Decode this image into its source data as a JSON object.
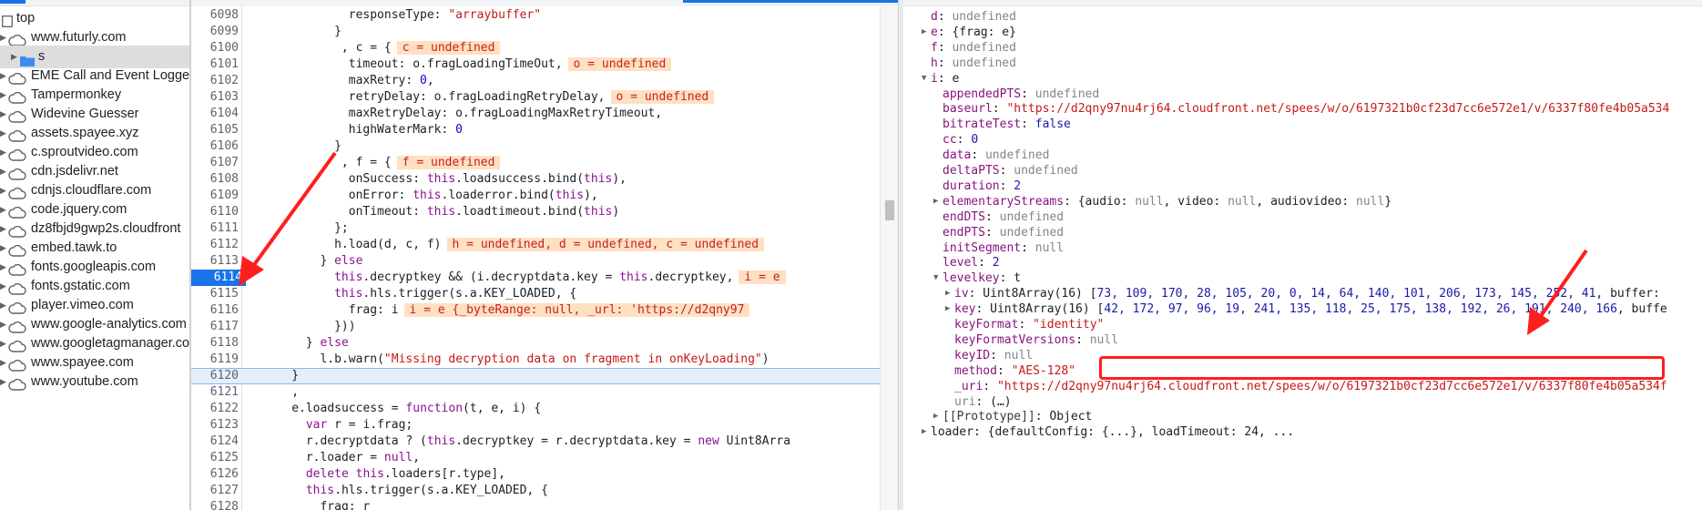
{
  "sidebar": {
    "items": [
      {
        "label": "top",
        "kind": "plain"
      },
      {
        "label": "www.futurly.com",
        "kind": "cloud"
      },
      {
        "label": "s",
        "kind": "folder",
        "selected": true
      },
      {
        "label": "EME Call and Event Logger",
        "kind": "cloud"
      },
      {
        "label": "Tampermonkey",
        "kind": "cloud"
      },
      {
        "label": "Widevine Guesser",
        "kind": "cloud"
      },
      {
        "label": "assets.spayee.xyz",
        "kind": "cloud"
      },
      {
        "label": "c.sproutvideo.com",
        "kind": "cloud"
      },
      {
        "label": "cdn.jsdelivr.net",
        "kind": "cloud"
      },
      {
        "label": "cdnjs.cloudflare.com",
        "kind": "cloud"
      },
      {
        "label": "code.jquery.com",
        "kind": "cloud"
      },
      {
        "label": "dz8fbjd9gwp2s.cloudfront",
        "kind": "cloud"
      },
      {
        "label": "embed.tawk.to",
        "kind": "cloud"
      },
      {
        "label": "fonts.googleapis.com",
        "kind": "cloud"
      },
      {
        "label": "fonts.gstatic.com",
        "kind": "cloud"
      },
      {
        "label": "player.vimeo.com",
        "kind": "cloud"
      },
      {
        "label": "www.google-analytics.com",
        "kind": "cloud"
      },
      {
        "label": "www.googletagmanager.co",
        "kind": "cloud"
      },
      {
        "label": "www.spayee.com",
        "kind": "cloud"
      },
      {
        "label": "www.youtube.com",
        "kind": "cloud"
      }
    ]
  },
  "editor": {
    "lines": [
      {
        "n": "6098",
        "indent": 29,
        "parts": [
          [
            "p",
            "responseType: "
          ],
          [
            "s",
            "\"arraybuffer\""
          ]
        ]
      },
      {
        "n": "6099",
        "indent": 25,
        "parts": [
          [
            "p",
            "}"
          ]
        ]
      },
      {
        "n": "6100",
        "indent": 27,
        "parts": [
          [
            "p",
            ", c = {"
          ]
        ],
        "ann": "c = undefined"
      },
      {
        "n": "6101",
        "indent": 29,
        "parts": [
          [
            "p",
            "timeout: o.fragLoadingTimeOut,"
          ]
        ],
        "ann": "o = undefined"
      },
      {
        "n": "6102",
        "indent": 29,
        "parts": [
          [
            "p",
            "maxRetry: "
          ],
          [
            "n",
            "0"
          ],
          [
            "p",
            ","
          ]
        ]
      },
      {
        "n": "6103",
        "indent": 29,
        "parts": [
          [
            "p",
            "retryDelay: o.fragLoadingRetryDelay,"
          ]
        ],
        "ann": "o = undefined"
      },
      {
        "n": "6104",
        "indent": 29,
        "parts": [
          [
            "p",
            "maxRetryDelay: o.fragLoadingMaxRetryTimeout,"
          ]
        ]
      },
      {
        "n": "6105",
        "indent": 29,
        "parts": [
          [
            "p",
            "highWaterMark: "
          ],
          [
            "n",
            "0"
          ]
        ]
      },
      {
        "n": "6106",
        "indent": 25,
        "parts": [
          [
            "p",
            "}"
          ]
        ]
      },
      {
        "n": "6107",
        "indent": 27,
        "parts": [
          [
            "p",
            ", f = {"
          ]
        ],
        "ann": "f = undefined"
      },
      {
        "n": "6108",
        "indent": 29,
        "parts": [
          [
            "p",
            "onSuccess: "
          ],
          [
            "k",
            "this"
          ],
          [
            "p",
            ".loadsuccess.bind("
          ],
          [
            "k",
            "this"
          ],
          [
            "p",
            "),"
          ]
        ]
      },
      {
        "n": "6109",
        "indent": 29,
        "parts": [
          [
            "p",
            "onError: "
          ],
          [
            "k",
            "this"
          ],
          [
            "p",
            ".loaderror.bind("
          ],
          [
            "k",
            "this"
          ],
          [
            "p",
            "),"
          ]
        ]
      },
      {
        "n": "6110",
        "indent": 29,
        "parts": [
          [
            "p",
            "onTimeout: "
          ],
          [
            "k",
            "this"
          ],
          [
            "p",
            ".loadtimeout.bind("
          ],
          [
            "k",
            "this"
          ],
          [
            "p",
            ")"
          ]
        ]
      },
      {
        "n": "6111",
        "indent": 25,
        "parts": [
          [
            "p",
            "};"
          ]
        ]
      },
      {
        "n": "6112",
        "indent": 25,
        "parts": [
          [
            "p",
            "h.load(d, c, f)"
          ]
        ],
        "ann": "h = undefined, d = undefined, c = undefined"
      },
      {
        "n": "6113",
        "indent": 21,
        "parts": [
          [
            "p",
            "} "
          ],
          [
            "k",
            "else"
          ]
        ]
      },
      {
        "n": "6114",
        "indent": 25,
        "bp": true,
        "parts": [
          [
            "k",
            "this"
          ],
          [
            "p",
            ".decryptkey && (i.decryptdata.key = "
          ],
          [
            "k",
            "this"
          ],
          [
            "p",
            ".decryptkey,"
          ]
        ],
        "ann": "i = e"
      },
      {
        "n": "6115",
        "indent": 25,
        "parts": [
          [
            "k",
            "this"
          ],
          [
            "p",
            ".hls.trigger(s.a.KEY_LOADED, {"
          ]
        ]
      },
      {
        "n": "6116",
        "indent": 29,
        "parts": [
          [
            "p",
            "frag: i"
          ]
        ],
        "ann": "i = e {_byteRange: null, _url: 'https://d2qny97"
      },
      {
        "n": "6117",
        "indent": 25,
        "parts": [
          [
            "p",
            "}))"
          ]
        ]
      },
      {
        "n": "6118",
        "indent": 17,
        "parts": [
          [
            "p",
            "} "
          ],
          [
            "k",
            "else"
          ]
        ]
      },
      {
        "n": "6119",
        "indent": 21,
        "parts": [
          [
            "p",
            "l.b.warn("
          ],
          [
            "s",
            "\"Missing decryption data on fragment in onKeyLoading\""
          ],
          [
            "p",
            ")"
          ]
        ]
      },
      {
        "n": "6120",
        "indent": 13,
        "current": true,
        "parts": [
          [
            "h",
            "}"
          ]
        ]
      },
      {
        "n": "6121",
        "indent": 13,
        "parts": [
          [
            "p",
            ","
          ]
        ]
      },
      {
        "n": "6122",
        "indent": 13,
        "parts": [
          [
            "p",
            "e.loadsuccess = "
          ],
          [
            "k",
            "function"
          ],
          [
            "p",
            "(t, e, i) {"
          ]
        ]
      },
      {
        "n": "6123",
        "indent": 17,
        "parts": [
          [
            "k",
            "var"
          ],
          [
            "p",
            " r = i.frag;"
          ]
        ]
      },
      {
        "n": "6124",
        "indent": 17,
        "parts": [
          [
            "p",
            "r.decryptdata ? ("
          ],
          [
            "k",
            "this"
          ],
          [
            "p",
            ".decryptkey = r.decryptdata.key = "
          ],
          [
            "k",
            "new"
          ],
          [
            "p",
            " Uint8Arra"
          ]
        ]
      },
      {
        "n": "6125",
        "indent": 17,
        "parts": [
          [
            "p",
            "r.loader = "
          ],
          [
            "k",
            "null"
          ],
          [
            "p",
            ","
          ]
        ]
      },
      {
        "n": "6126",
        "indent": 17,
        "parts": [
          [
            "k",
            "delete this"
          ],
          [
            "p",
            ".loaders[r.type],"
          ]
        ]
      },
      {
        "n": "6127",
        "indent": 17,
        "parts": [
          [
            "k",
            "this"
          ],
          [
            "p",
            ".hls.trigger(s.a.KEY_LOADED, {"
          ]
        ]
      },
      {
        "n": "6128",
        "indent": 21,
        "parts": [
          [
            "p",
            "frag: r"
          ]
        ]
      }
    ]
  },
  "scope": {
    "rows": [
      {
        "indent": 0,
        "tri": "",
        "parts": [
          [
            "k",
            "d"
          ],
          [
            "p",
            ": "
          ],
          [
            "u",
            "undefined"
          ]
        ]
      },
      {
        "indent": 0,
        "tri": "▶",
        "parts": [
          [
            "k",
            "e"
          ],
          [
            "p",
            ": {frag: e}"
          ]
        ]
      },
      {
        "indent": 0,
        "tri": "",
        "parts": [
          [
            "k",
            "f"
          ],
          [
            "p",
            ": "
          ],
          [
            "u",
            "undefined"
          ]
        ]
      },
      {
        "indent": 0,
        "tri": "",
        "parts": [
          [
            "k",
            "h"
          ],
          [
            "p",
            ": "
          ],
          [
            "u",
            "undefined"
          ]
        ]
      },
      {
        "indent": 0,
        "tri": "▼",
        "parts": [
          [
            "k",
            "i"
          ],
          [
            "p",
            ": e"
          ]
        ]
      },
      {
        "indent": 1,
        "tri": "",
        "parts": [
          [
            "k",
            "appendedPTS"
          ],
          [
            "p",
            ": "
          ],
          [
            "u",
            "undefined"
          ]
        ]
      },
      {
        "indent": 1,
        "tri": "",
        "parts": [
          [
            "k",
            "baseurl"
          ],
          [
            "p",
            ": "
          ],
          [
            "s",
            "\"https://d2qny97nu4rj64.cloudfront.net/spees/w/o/6197321b0cf23d7cc6e572e1/v/6337f80fe4b05a534"
          ]
        ]
      },
      {
        "indent": 1,
        "tri": "",
        "parts": [
          [
            "k",
            "bitrateTest"
          ],
          [
            "p",
            ": "
          ],
          [
            "n",
            "false"
          ]
        ]
      },
      {
        "indent": 1,
        "tri": "",
        "parts": [
          [
            "k",
            "cc"
          ],
          [
            "p",
            ": "
          ],
          [
            "n",
            "0"
          ]
        ]
      },
      {
        "indent": 1,
        "tri": "",
        "parts": [
          [
            "k",
            "data"
          ],
          [
            "p",
            ": "
          ],
          [
            "u",
            "undefined"
          ]
        ]
      },
      {
        "indent": 1,
        "tri": "",
        "parts": [
          [
            "k",
            "deltaPTS"
          ],
          [
            "p",
            ": "
          ],
          [
            "u",
            "undefined"
          ]
        ]
      },
      {
        "indent": 1,
        "tri": "",
        "parts": [
          [
            "k",
            "duration"
          ],
          [
            "p",
            ": "
          ],
          [
            "n",
            "2"
          ]
        ]
      },
      {
        "indent": 1,
        "tri": "▶",
        "parts": [
          [
            "k",
            "elementaryStreams"
          ],
          [
            "p",
            ": {audio: "
          ],
          [
            "u",
            "null"
          ],
          [
            "p",
            ", video: "
          ],
          [
            "u",
            "null"
          ],
          [
            "p",
            ", audiovideo: "
          ],
          [
            "u",
            "null"
          ],
          [
            "p",
            "}"
          ]
        ]
      },
      {
        "indent": 1,
        "tri": "",
        "parts": [
          [
            "k",
            "endDTS"
          ],
          [
            "p",
            ": "
          ],
          [
            "u",
            "undefined"
          ]
        ]
      },
      {
        "indent": 1,
        "tri": "",
        "parts": [
          [
            "k",
            "endPTS"
          ],
          [
            "p",
            ": "
          ],
          [
            "u",
            "undefined"
          ]
        ]
      },
      {
        "indent": 1,
        "tri": "",
        "parts": [
          [
            "k",
            "initSegment"
          ],
          [
            "p",
            ": "
          ],
          [
            "u",
            "null"
          ]
        ]
      },
      {
        "indent": 1,
        "tri": "",
        "parts": [
          [
            "k",
            "level"
          ],
          [
            "p",
            ": "
          ],
          [
            "n",
            "2"
          ]
        ]
      },
      {
        "indent": 1,
        "tri": "▼",
        "parts": [
          [
            "k",
            "levelkey"
          ],
          [
            "p",
            ": t"
          ]
        ]
      },
      {
        "indent": 2,
        "tri": "▶",
        "parts": [
          [
            "k",
            "iv"
          ],
          [
            "p",
            ": Uint8Array(16) ["
          ],
          [
            "n",
            "73, 109, 170, 28, 105, 20, 0, 14, 64, 140, 101, 206, 173, 145, 252, 41"
          ],
          [
            "p",
            ", buffer:"
          ]
        ]
      },
      {
        "indent": 2,
        "tri": "▶",
        "parts": [
          [
            "k",
            "key"
          ],
          [
            "p",
            ": Uint8Array(16) ["
          ],
          [
            "n",
            "42, 172, 97, 96, 19, 241, 135, 118, 25, 175, 138, 192, 26, 191, 240, 166"
          ],
          [
            "p",
            ", buffe"
          ]
        ]
      },
      {
        "indent": 2,
        "tri": "",
        "parts": [
          [
            "k",
            "keyFormat"
          ],
          [
            "p",
            ": "
          ],
          [
            "s",
            "\"identity\""
          ]
        ]
      },
      {
        "indent": 2,
        "tri": "",
        "parts": [
          [
            "k",
            "keyFormatVersions"
          ],
          [
            "p",
            ": "
          ],
          [
            "u",
            "null"
          ]
        ]
      },
      {
        "indent": 2,
        "tri": "",
        "parts": [
          [
            "k",
            "keyID"
          ],
          [
            "p",
            ": "
          ],
          [
            "u",
            "null"
          ]
        ]
      },
      {
        "indent": 2,
        "tri": "",
        "parts": [
          [
            "k",
            "method"
          ],
          [
            "p",
            ": "
          ],
          [
            "s",
            "\"AES-128\""
          ]
        ]
      },
      {
        "indent": 2,
        "tri": "",
        "parts": [
          [
            "k",
            "_uri"
          ],
          [
            "p",
            ": "
          ],
          [
            "s",
            "\"https://d2qny97nu4rj64.cloudfront.net/spees/w/o/6197321b0cf23d7cc6e572e1/v/6337f80fe4b05a534f"
          ]
        ]
      },
      {
        "indent": 2,
        "tri": "",
        "parts": [
          [
            "u",
            "uri"
          ],
          [
            "p",
            ": (…)"
          ]
        ]
      },
      {
        "indent": 1,
        "tri": "▶",
        "parts": [
          [
            "k2",
            "[[Prototype]]"
          ],
          [
            "p",
            ": Object"
          ]
        ]
      },
      {
        "indent": 0,
        "tri": "▶",
        "parts": [
          [
            "p",
            "loader: {defaultConfig: {...}, loadTimeout: 24, ..."
          ]
        ]
      }
    ]
  },
  "colors": {
    "accent": "#1a73e8",
    "annotation_red": "#ff1e1e",
    "highlight_bg": "#ffe0c2"
  }
}
